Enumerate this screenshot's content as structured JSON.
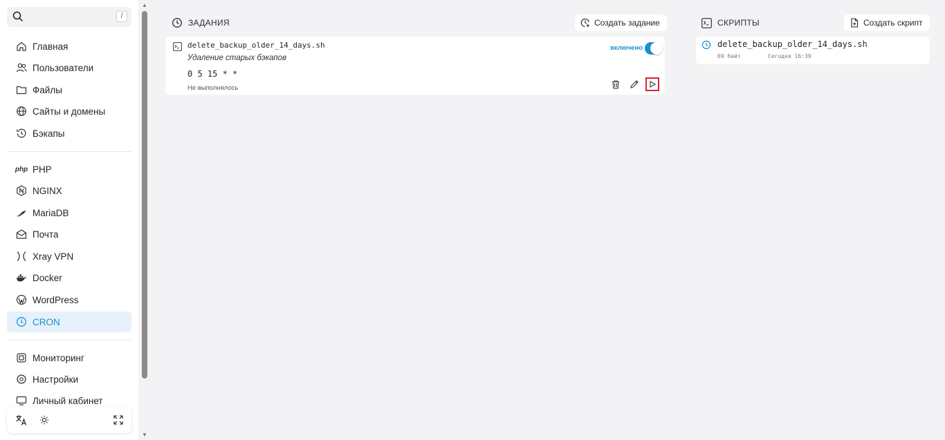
{
  "search": {
    "placeholder": "",
    "shortcut": "/"
  },
  "sidebar": {
    "group1": [
      {
        "label": "Главная",
        "icon": "home-icon"
      },
      {
        "label": "Пользователи",
        "icon": "users-icon"
      },
      {
        "label": "Файлы",
        "icon": "folder-icon"
      },
      {
        "label": "Сайты и домены",
        "icon": "globe-icon"
      },
      {
        "label": "Бэкапы",
        "icon": "history-icon"
      }
    ],
    "group2": [
      {
        "label": "PHP",
        "icon": "php-icon"
      },
      {
        "label": "NGINX",
        "icon": "nginx-icon"
      },
      {
        "label": "MariaDB",
        "icon": "mariadb-icon"
      },
      {
        "label": "Почта",
        "icon": "mail-icon"
      },
      {
        "label": "Xray VPN",
        "icon": "xray-icon"
      },
      {
        "label": "Docker",
        "icon": "docker-icon"
      },
      {
        "label": "WordPress",
        "icon": "wordpress-icon"
      },
      {
        "label": "CRON",
        "icon": "clock-icon",
        "active": true
      }
    ],
    "group3": [
      {
        "label": "Мониторинг",
        "icon": "cpu-icon"
      },
      {
        "label": "Настройки",
        "icon": "settings-icon"
      },
      {
        "label": "Личный кабинет",
        "icon": "monitor-icon"
      }
    ]
  },
  "tasks": {
    "title": "ЗАДАНИЯ",
    "create_label": "Создать задание",
    "items": [
      {
        "name": "delete_backup_older_14_days.sh",
        "description": "Удаление старых бэкапов",
        "schedule": "0 5 15 * *",
        "status": "Не выполнялось",
        "toggle_label": "включено",
        "enabled": true
      }
    ]
  },
  "scripts": {
    "title": "СКРИПТЫ",
    "create_label": "Создать скрипт",
    "items": [
      {
        "name": "delete_backup_older_14_days.sh",
        "size": "69 байт",
        "modified": "Сегодня 16:39"
      }
    ]
  },
  "colors": {
    "accent": "#1a8fd2",
    "active_bg": "#e6f1fb",
    "highlight": "#d9232d"
  }
}
